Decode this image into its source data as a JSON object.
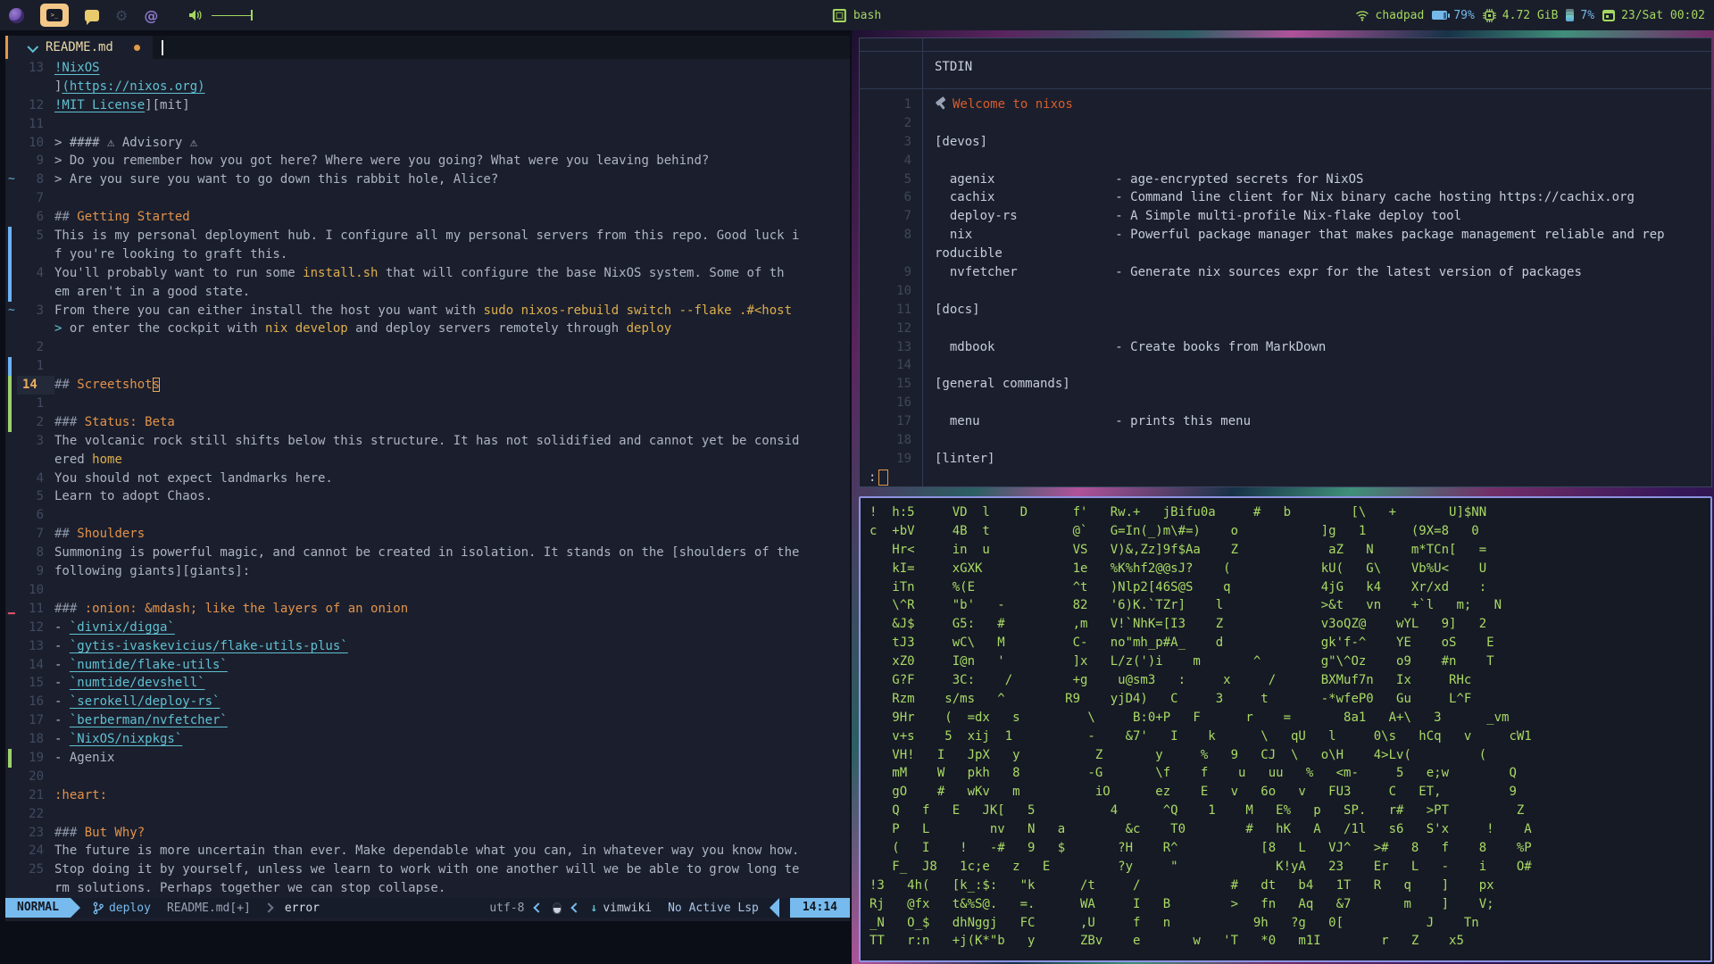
{
  "colors": {
    "accent_orange": "#e09a4a",
    "heading_orange": "#e2924a",
    "code_yellow": "#ddae4e",
    "link_cyan": "#5fc0d2",
    "ui_blue": "#77bbee",
    "bar_green": "#a5d75f",
    "matrix_green": "#a9da64",
    "welcome_orange": "#d95c2b"
  },
  "topbar": {
    "title": "bash",
    "net": "chadpad",
    "battery": "79%",
    "memory": "4.72 GiB",
    "cpu": "7%",
    "clock": "23/Sat 00:02",
    "icons": [
      "firefox",
      "terminal",
      "chat",
      "gear",
      "at",
      "volume"
    ]
  },
  "editor": {
    "tab_title": "README.md",
    "rows": [
      {
        "n": "13",
        "seg": [
          [
            "l",
            "!NixOS"
          ]
        ]
      },
      {
        "n": "",
        "seg": [
          [
            "t",
            "]"
          ],
          [
            "l",
            "(https://nixos.org)"
          ]
        ]
      },
      {
        "n": "12",
        "seg": [
          [
            "l",
            "!MIT License"
          ],
          [
            "t",
            "][mit]"
          ]
        ]
      },
      {
        "n": "11",
        "seg": []
      },
      {
        "n": "10",
        "seg": [
          [
            "t",
            "> #### ⚠ Advisory ⚠"
          ]
        ]
      },
      {
        "n": "9",
        "seg": [
          [
            "t",
            "> Do you remember how you got here? Where were you going? What were you leaving behind?"
          ]
        ]
      },
      {
        "n": "8",
        "s": "~",
        "seg": [
          [
            "t",
            "> Are you sure you want to go down this rabbit hole, Alice?"
          ]
        ]
      },
      {
        "n": "7",
        "seg": []
      },
      {
        "n": "6",
        "seg": [
          [
            "p",
            "## "
          ],
          [
            "h",
            "Getting Started"
          ]
        ]
      },
      {
        "n": "5",
        "s": "bb",
        "seg": [
          [
            "t",
            "This is my personal deployment hub. I configure all my personal servers from this repo. Good luck i"
          ]
        ]
      },
      {
        "n": "",
        "s": "bb",
        "seg": [
          [
            "t",
            "f you're looking to graft this."
          ]
        ]
      },
      {
        "n": "4",
        "s": "bb",
        "seg": [
          [
            "t",
            "You'll probably want to run some "
          ],
          [
            "c",
            "install.sh"
          ],
          [
            "t",
            " that will configure the base NixOS system. Some of th"
          ]
        ]
      },
      {
        "n": "",
        "s": "bb",
        "seg": [
          [
            "t",
            "em aren't in a good state."
          ]
        ]
      },
      {
        "n": "3",
        "s": "~",
        "seg": [
          [
            "t",
            "From there you can either install the host you want with "
          ],
          [
            "c",
            "sudo nixos-rebuild switch --flake .#<host"
          ]
        ]
      },
      {
        "n": "",
        "seg": [
          [
            "y",
            "> "
          ],
          [
            "t",
            "or enter the cockpit with "
          ],
          [
            "c",
            "nix develop"
          ],
          [
            "t",
            " and deploy servers remotely through "
          ],
          [
            "c",
            "deploy"
          ]
        ]
      },
      {
        "n": "2",
        "seg": []
      },
      {
        "n": "1",
        "s": "bb",
        "seg": []
      },
      {
        "n": "14",
        "c": true,
        "s": "bg",
        "seg": [
          [
            "p",
            "## "
          ],
          [
            "h",
            "Screetshot"
          ],
          [
            "k",
            "s"
          ]
        ]
      },
      {
        "n": "1",
        "s": "bg",
        "seg": []
      },
      {
        "n": "2",
        "s": "bg",
        "seg": [
          [
            "p",
            "### "
          ],
          [
            "h",
            "Status: Beta"
          ]
        ]
      },
      {
        "n": "3",
        "seg": [
          [
            "t",
            "The volcanic rock still shifts below this structure. It has not solidified and cannot yet be consid"
          ]
        ]
      },
      {
        "n": "",
        "seg": [
          [
            "t",
            "ered "
          ],
          [
            "c",
            "home"
          ]
        ]
      },
      {
        "n": "4",
        "seg": [
          [
            "t",
            "You should not expect landmarks here."
          ]
        ]
      },
      {
        "n": "5",
        "seg": [
          [
            "t",
            "Learn to adopt Chaos."
          ]
        ]
      },
      {
        "n": "6",
        "seg": []
      },
      {
        "n": "7",
        "seg": [
          [
            "p",
            "## "
          ],
          [
            "h",
            "Shoulders"
          ]
        ]
      },
      {
        "n": "8",
        "seg": [
          [
            "t",
            "Summoning is powerful magic, and cannot be created in isolation. It stands on the [shoulders of the"
          ]
        ]
      },
      {
        "n": "9",
        "seg": [
          [
            "t",
            "following giants][giants]:"
          ]
        ]
      },
      {
        "n": "10",
        "seg": []
      },
      {
        "n": "11",
        "s": "rd",
        "seg": [
          [
            "p",
            "### "
          ],
          [
            "h",
            ":onion: &mdash; like the layers of an onion"
          ]
        ]
      },
      {
        "n": "12",
        "seg": [
          [
            "t",
            "- "
          ],
          [
            "l",
            "`divnix/digga`"
          ]
        ]
      },
      {
        "n": "13",
        "seg": [
          [
            "t",
            "- "
          ],
          [
            "l",
            "`gytis-ivaskevicius/flake-utils-plus`"
          ]
        ]
      },
      {
        "n": "14",
        "seg": [
          [
            "t",
            "- "
          ],
          [
            "l",
            "`numtide/flake-utils`"
          ]
        ]
      },
      {
        "n": "15",
        "seg": [
          [
            "t",
            "- "
          ],
          [
            "l",
            "`numtide/devshell`"
          ]
        ]
      },
      {
        "n": "16",
        "seg": [
          [
            "t",
            "- "
          ],
          [
            "l",
            "`serokell/deploy-rs`"
          ]
        ]
      },
      {
        "n": "17",
        "seg": [
          [
            "t",
            "- "
          ],
          [
            "l",
            "`berberman/nvfetcher`"
          ]
        ]
      },
      {
        "n": "18",
        "seg": [
          [
            "t",
            "- "
          ],
          [
            "l",
            "`NixOS/nixpkgs`"
          ]
        ]
      },
      {
        "n": "19",
        "s": "bg",
        "seg": [
          [
            "t",
            "- Agenix"
          ]
        ]
      },
      {
        "n": "20",
        "seg": []
      },
      {
        "n": "21",
        "seg": [
          [
            "h",
            ":heart:"
          ]
        ]
      },
      {
        "n": "22",
        "seg": []
      },
      {
        "n": "23",
        "seg": [
          [
            "p",
            "### "
          ],
          [
            "h",
            "But Why?"
          ]
        ]
      },
      {
        "n": "24",
        "seg": [
          [
            "t",
            "The future is more uncertain than ever. Make dependable what you can, in whatever way you know how."
          ]
        ]
      },
      {
        "n": "25",
        "seg": [
          [
            "t",
            "Stop doing it by yourself, unless we learn to work with one another will we be able to grow long te"
          ]
        ]
      },
      {
        "n": "",
        "seg": [
          [
            "t",
            "rm solutions. Perhaps together we can stop collapse."
          ]
        ]
      }
    ],
    "statusline": {
      "mode": "NORMAL",
      "branch": "deploy",
      "file": "README.md[+]",
      "diagnostic": "error",
      "encoding": "utf-8",
      "filetype": "vimwiki",
      "lsp": "No Active Lsp",
      "time": "14:14"
    }
  },
  "pager": {
    "header": "STDIN",
    "prompt": ":",
    "rows": [
      {
        "n": "1",
        "seg": [
          [
            "ham",
            ""
          ],
          [
            "wel",
            "Welcome to nixos"
          ]
        ]
      },
      {
        "n": "2",
        "seg": []
      },
      {
        "n": "3",
        "seg": [
          [
            "pl",
            "[devos]"
          ]
        ]
      },
      {
        "n": "4",
        "seg": []
      },
      {
        "n": "5",
        "seg": [
          [
            "pl",
            "  agenix                - age-encrypted secrets for NixOS"
          ]
        ]
      },
      {
        "n": "6",
        "seg": [
          [
            "pl",
            "  cachix                - Command line client for Nix binary cache hosting https://cachix.org"
          ]
        ]
      },
      {
        "n": "7",
        "seg": [
          [
            "pl",
            "  deploy-rs             - A Simple multi-profile Nix-flake deploy tool"
          ]
        ]
      },
      {
        "n": "8",
        "seg": [
          [
            "pl",
            "  nix                   - Powerful package manager that makes package management reliable and rep"
          ]
        ]
      },
      {
        "n": "",
        "seg": [
          [
            "pl",
            "roducible"
          ]
        ]
      },
      {
        "n": "9",
        "seg": [
          [
            "pl",
            "  nvfetcher             - Generate nix sources expr for the latest version of packages"
          ]
        ]
      },
      {
        "n": "10",
        "seg": []
      },
      {
        "n": "11",
        "seg": [
          [
            "pl",
            "[docs]"
          ]
        ]
      },
      {
        "n": "12",
        "seg": []
      },
      {
        "n": "13",
        "seg": [
          [
            "pl",
            "  mdbook                - Create books from MarkDown"
          ]
        ]
      },
      {
        "n": "14",
        "seg": []
      },
      {
        "n": "15",
        "seg": [
          [
            "pl",
            "[general commands]"
          ]
        ]
      },
      {
        "n": "16",
        "seg": []
      },
      {
        "n": "17",
        "seg": [
          [
            "pl",
            "  menu                  - prints this menu"
          ]
        ]
      },
      {
        "n": "18",
        "seg": []
      },
      {
        "n": "19",
        "seg": [
          [
            "pl",
            "[linter]"
          ]
        ]
      }
    ]
  },
  "matrix": {
    "rows": [
      "!  h:5     VD  l    D      f'   Rw.+   jBifu0a     #   b        [\\   +       U]$NN",
      "c  +bV     4B  t           @`   G=In(_)m\\#=)    o           ]g   1      (9X=8   0",
      "   Hr<     in  u           VS   V)&,Zz]9f$Aa    Z            aZ   N     m*TCn[   =",
      "   kI=     xGXK            1e   %K%hf2@@sJ?    (            kU(   G\\    Vb%U<    U",
      "   iTn     %(E             ^t   )Nlp2[46S@S    q            4jG   k4    Xr/xd    :",
      "   \\^R     \"b'   -         82   '6)K.`TZr]    l             >&t   vn    +`l   m;   N",
      "   &J$     G5:   #         ,m   V!`NhK=[I3    Z             v3oQZ@    wYL   9]   2",
      "   tJ3     wC\\   M         C-   no\"mh_p#A_    d             gk'f-^    YE    oS    E",
      "   xZ0     I@n   '         ]x   L/z(')i    m       ^        g\"\\^Oz    o9    #n    T",
      "   G?F     3C:    /        +g    u@sm3   :     x     /      BXMuf7n   Ix     RHc",
      "   Rzm    s/ms   ^        R9    yjD4)   C     3     t       -*wfeP0   Gu     L^F",
      "   9Hr    (  =dx   s         \\     B:0+P   F      r    =       8a1   A+\\   3      _vm",
      "   v+s    5  xij  1          -    &7'   I    k      \\   qU   l     0\\s   hCq   v     cW1",
      "   VH!   I   JpX   y          Z       y     %   9   CJ  \\   o\\H    4>Lv(         (",
      "   mM    W   pkh   8         -G       \\f    f    u   uu   %   <m-     5   e;w        Q",
      "   gO    #   wKv   m          iO      ez    E   v   6o   v   FU3     C   ET,         9",
      "   Q   f   E   JK[   5          4      ^Q    1    M   E%   p   SP.   r#   >PT         Z",
      "   P   L        nv   N   a        &c    T0        #   hK   A   /1l   s6   S'x     !    A",
      "   (   I    !   -#   9   $       ?H    R^           [8   L   VJ^   >#   8   f    8    %P",
      "   F_  J8   1c;e   z   E         ?y     \"             K!yA   23    Er   L   -    i    O#",
      "!3   4h(   [k_:$:   \"k      /t     /            #   dt   b4   1T   R   q    ]    px",
      "Rj   @fx   t&%S@.   =.      WA     I   B        >   fn   Aq   &7       m    ]    V;",
      "_N   O_$   dhNggj   FC      ,U     f   n           9h   ?g   0[           J    Tn",
      "TT   r:n   +j(K*\"b   y      ZBv    e       w   'T   *0   m1I        r   Z    x5"
    ]
  }
}
